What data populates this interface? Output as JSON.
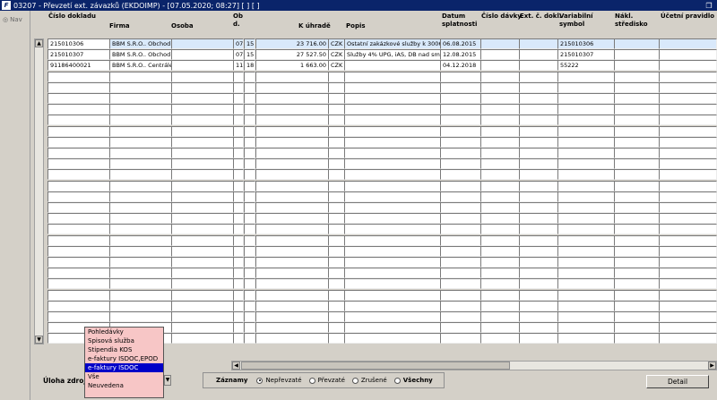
{
  "window": {
    "title": "03207 - Převzetí ext. závazků (EKDOIMP) - [07.05.2020; 08:27]  [  ]  [ ]",
    "app_icon": "F",
    "restore_icon": "restore-icon"
  },
  "nav": {
    "label": "Nav"
  },
  "columns": {
    "cislo_dokladu": "Číslo dokladu",
    "firma": "Firma",
    "osoba": "Osoba",
    "obd": "Ob d.",
    "k_uhrade": "K úhradě",
    "popis": "Popis",
    "datum_splatnosti": "Datum splatnosti",
    "cislo_davky": "Číslo dávky",
    "ext_c_dokl": "Ext. č. dokl.",
    "variabilni_symbol": "Variabilní symbol",
    "nakl_stredisko": "Nákl. středisko",
    "ucetni_pravidlo": "Účetní pravidlo"
  },
  "rows": [
    {
      "cislo": "215010306",
      "firma": "BBM S.R.O.. Obchod",
      "osoba": "",
      "ob": "07",
      "d": "15",
      "k_uhrade": "23 716.00",
      "mena": "CZK",
      "popis": "Ostatní zakázkové služby k 3006",
      "datum": "06.08.2015",
      "davka": "",
      "ext": "",
      "vs": "215010306",
      "stredisko": "",
      "pravidlo": ""
    },
    {
      "cislo": "215010307",
      "firma": "BBM S.R.O.. Obchod",
      "osoba": "",
      "ob": "07",
      "d": "15",
      "k_uhrade": "27 527.50",
      "mena": "CZK",
      "popis": "Služby 4% UPG, iAS, DB nad smi",
      "datum": "12.08.2015",
      "davka": "",
      "ext": "",
      "vs": "215010307",
      "stredisko": "",
      "pravidlo": ""
    },
    {
      "cislo": "91186400021",
      "firma": "BBM S.R.O.. Centrále",
      "osoba": "",
      "ob": "11",
      "d": "18",
      "k_uhrade": "1 663.00",
      "mena": "CZK",
      "popis": "",
      "datum": "04.12.2018",
      "davka": "",
      "ext": "",
      "vs": "55222",
      "stredisko": "",
      "pravidlo": ""
    }
  ],
  "bottom": {
    "uloha_label": "Úloha zdroje",
    "dropdown_options": [
      "Pohledávky",
      "Spisová služba",
      "Stipendia KOS",
      "e-faktury ISDOC,EPOD",
      "e-faktury ISDOC",
      "Vše",
      "Neuvedena"
    ],
    "selected_option": "e-faktury ISDOC",
    "zaznamy_label": "Záznamy",
    "radios": [
      "Nepřevzaté",
      "Převzaté",
      "Zrušené",
      "Všechny"
    ],
    "radio_selected": "Nepřevzaté",
    "detail_button": "Detail"
  },
  "colors": {
    "titlebar": "#0a246a",
    "selected_row": "#d9e9fb",
    "listbox_bg": "#f7c6c6",
    "listbox_selected": "#0000c8"
  }
}
